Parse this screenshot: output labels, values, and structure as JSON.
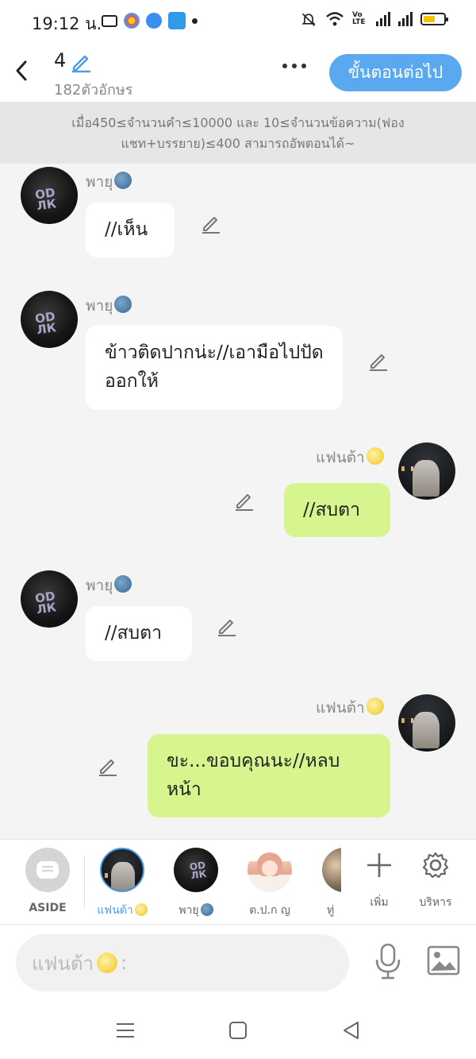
{
  "status_bar": {
    "time": "19:12 น."
  },
  "header": {
    "episode_number": "4",
    "char_count": "182ตัวอักษร",
    "next_button_label": "ขั้นตอนต่อไป"
  },
  "info_banner": {
    "text": "เมื่อ450≤จำนวนคำ≤10000 และ 10≤จำนวนข้อความ(ฟองแชท+บรรยาย)≤400 สามารถอัพตอนได้~"
  },
  "messages": [
    {
      "sender": "พายุ",
      "side": "left",
      "text": "//เห็น"
    },
    {
      "sender": "พายุ",
      "side": "left",
      "text": "ข้าวติดปากน่ะ//เอามือไปปัดออกให้"
    },
    {
      "sender": "แฟนต้า",
      "side": "right",
      "text": "//สบตา"
    },
    {
      "sender": "พายุ",
      "side": "left",
      "text": "//สบตา"
    },
    {
      "sender": "แฟนต้า",
      "side": "right",
      "text": "ขะ...ขอบคุณนะ//หลบหน้า"
    }
  ],
  "character_bar": {
    "aside_label": "ASIDE",
    "characters": [
      {
        "name": "แฟนต้า",
        "selected": true
      },
      {
        "name": "พายุ",
        "selected": false
      },
      {
        "name": "ต.ป.ก ญ",
        "selected": false
      },
      {
        "name": "ทู่",
        "selected": false
      }
    ],
    "add_label": "เพิ่ม",
    "manage_label": "บริหาร"
  },
  "composer": {
    "placeholder": "แฟนต้า",
    "placeholder_suffix": ":"
  },
  "colors": {
    "accent_blue": "#5aa9f0",
    "bubble_right": "#d6f58f",
    "bubble_left": "#ffffff",
    "chat_background": "#f4f4f4",
    "banner_background": "#e6e6e6"
  },
  "icons": {
    "back": "chevron-left-icon",
    "episode_edit": "pencil-icon",
    "more": "more-dots-icon",
    "message_edit": "pencil-icon",
    "add": "plus-icon",
    "manage": "gear-icon",
    "mic": "microphone-icon",
    "image": "image-icon",
    "nav_menu": "menu-icon",
    "nav_home": "square-icon",
    "nav_back": "triangle-back-icon"
  }
}
